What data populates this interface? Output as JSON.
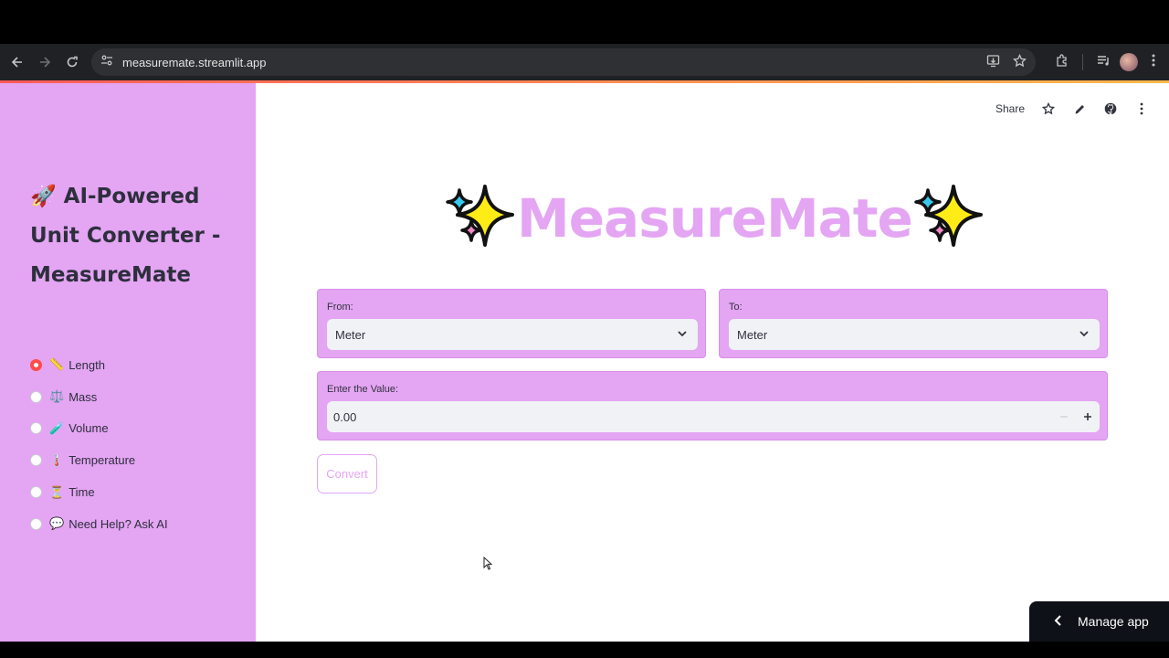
{
  "browser": {
    "url": "measuremate.streamlit.app"
  },
  "sidebar": {
    "title": "🚀 AI-Powered Unit Converter - MeasureMate",
    "options": [
      {
        "emoji": "📏",
        "label": "Length",
        "selected": true
      },
      {
        "emoji": "⚖️",
        "label": "Mass",
        "selected": false
      },
      {
        "emoji": "🧪",
        "label": "Volume",
        "selected": false
      },
      {
        "emoji": "🌡️",
        "label": "Temperature",
        "selected": false
      },
      {
        "emoji": "⏳",
        "label": "Time",
        "selected": false
      },
      {
        "emoji": "💬",
        "label": "Need Help? Ask AI",
        "selected": false
      }
    ]
  },
  "toolbar": {
    "share_label": "Share"
  },
  "hero": {
    "emoji_left": "✨",
    "title": "MeasureMate",
    "emoji_right": "✨"
  },
  "form": {
    "from_label": "From:",
    "from_value": "Meter",
    "to_label": "To:",
    "to_value": "Meter",
    "value_label": "Enter the Value:",
    "value": "0.00",
    "convert_label": "Convert"
  },
  "footer": {
    "manage_label": "Manage app"
  },
  "colors": {
    "accent": "#e4a5f3",
    "radio_selected": "#ff4b4b",
    "manage_bg": "#0e1117"
  }
}
